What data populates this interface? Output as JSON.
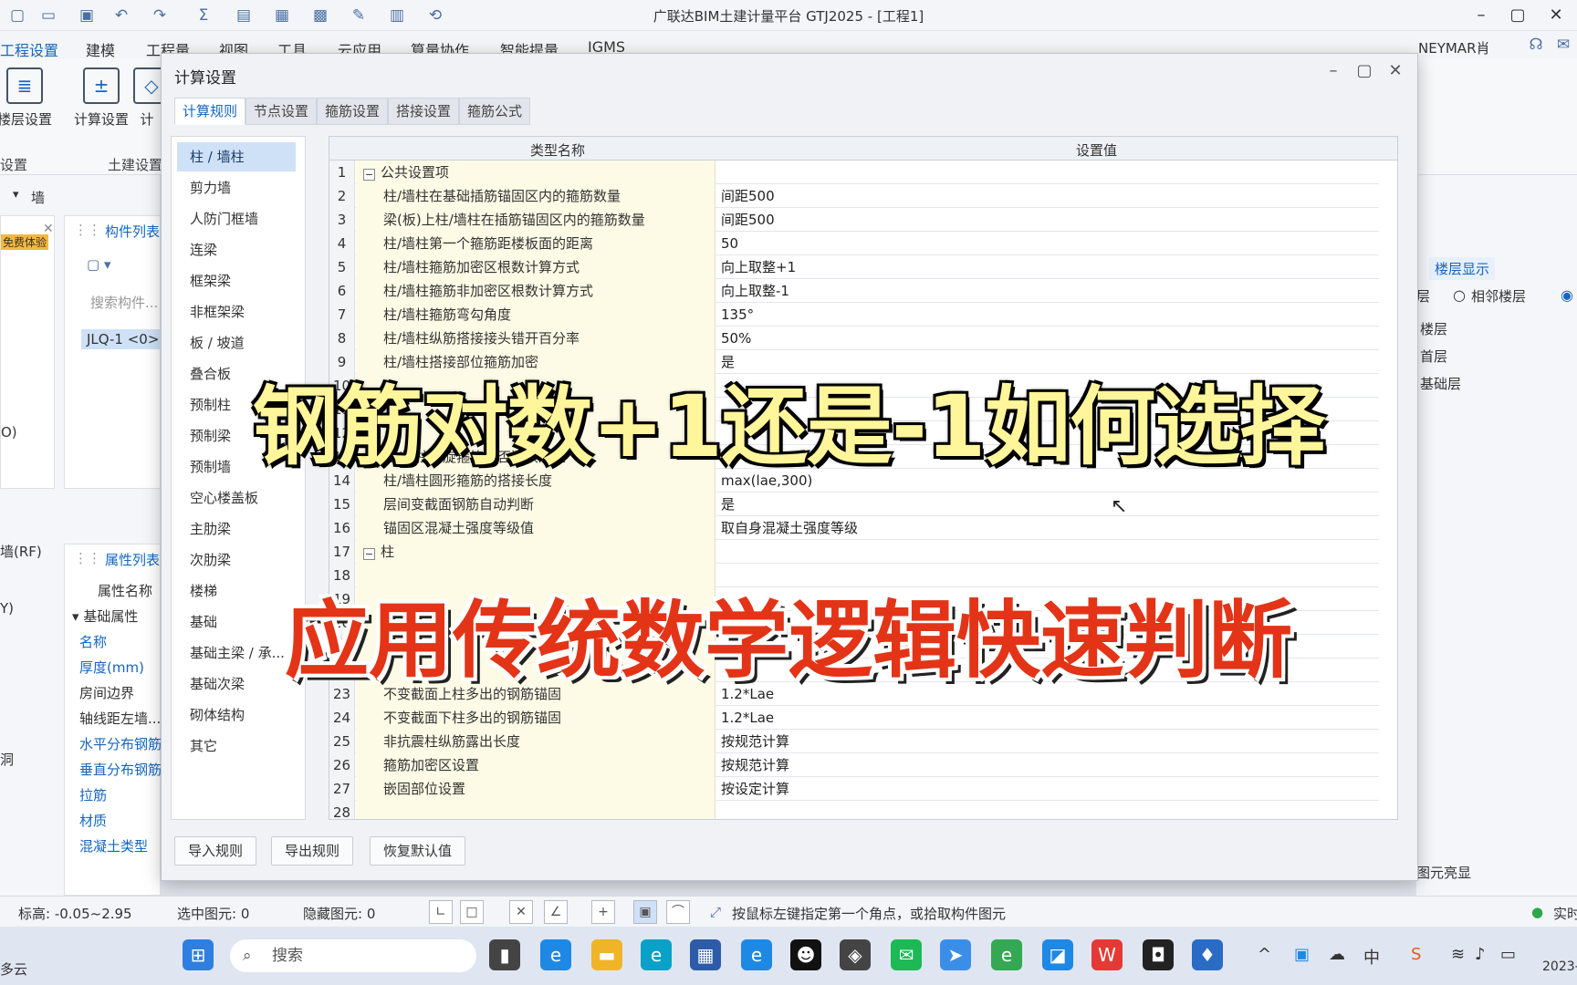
{
  "app": {
    "title": "广联达BIM土建计量平台 GTJ2025 - [工程1]",
    "user": "NEYMAR肖"
  },
  "menu": [
    "工程设置",
    "建模",
    "工程量",
    "视图",
    "工具",
    "云应用",
    "算量协作",
    "智能提量",
    "IGMS"
  ],
  "ribbon": {
    "buttons": [
      "楼层设置",
      "计算设置",
      "计"
    ],
    "groups": [
      "设置",
      "土建设置"
    ]
  },
  "left_panel": {
    "selector_label": "墙",
    "component_list_title": "构件列表",
    "search_placeholder": "搜索构件...",
    "item": "JLQ-1 <0>",
    "badge": "免费体验",
    "property_list_title": "属性列表",
    "prop_header": "属性名称",
    "prop_section": "基础属性",
    "props": [
      "名称",
      "厚度(mm)",
      "房间边界",
      "轴线距左墙...",
      "水平分布钢筋",
      "垂直分布钢筋",
      "拉筋",
      "材质",
      "混凝土类型"
    ],
    "edge_labels": [
      "O)",
      "墙(RF)",
      "Y)",
      "洞",
      "多云"
    ]
  },
  "right_panel": {
    "tab": "楼层显示",
    "radio_labels": [
      "层",
      "相邻楼层"
    ],
    "floors": [
      "楼层",
      "首层",
      "基础层"
    ],
    "bottom_label": "图元亮显"
  },
  "dialog": {
    "title": "计算设置",
    "tabs": [
      "计算规则",
      "节点设置",
      "箍筋设置",
      "搭接设置",
      "箍筋公式"
    ],
    "categories": [
      "柱 / 墙柱",
      "剪力墙",
      "人防门框墙",
      "连梁",
      "框架梁",
      "非框架梁",
      "板 / 坡道",
      "叠合板",
      "预制柱",
      "预制梁",
      "预制墙",
      "空心楼盖板",
      "主肋梁",
      "次肋梁",
      "楼梯",
      "基础",
      "基础主梁 / 承...",
      "基础次梁",
      "砌体结构",
      "其它"
    ],
    "grid_headers": [
      "类型名称",
      "设置值"
    ],
    "rows": [
      {
        "n": "1",
        "name": "公共设置项",
        "value": "",
        "group": true
      },
      {
        "n": "2",
        "name": "柱/墙柱在基础插筋锚固区内的箍筋数量",
        "value": "间距500"
      },
      {
        "n": "3",
        "name": "梁(板)上柱/墙柱在插筋锚固区内的箍筋数量",
        "value": "间距500"
      },
      {
        "n": "4",
        "name": "柱/墙柱第一个箍筋距楼板面的距离",
        "value": "50"
      },
      {
        "n": "5",
        "name": "柱/墙柱箍筋加密区根数计算方式",
        "value": "向上取整+1"
      },
      {
        "n": "6",
        "name": "柱/墙柱箍筋非加密区根数计算方式",
        "value": "向上取整-1"
      },
      {
        "n": "7",
        "name": "柱/墙柱箍筋弯勾角度",
        "value": "135°"
      },
      {
        "n": "8",
        "name": "柱/墙柱纵筋搭接接头错开百分率",
        "value": "50%"
      },
      {
        "n": "9",
        "name": "柱/墙柱搭接部位箍筋加密",
        "value": "是"
      },
      {
        "n": "10",
        "name": "",
        "value": ""
      },
      {
        "n": "11",
        "name": "",
        "value": ""
      },
      {
        "n": "12",
        "name": "",
        "value": ""
      },
      {
        "n": "13",
        "name": "柱/墙柱螺旋箍筋是否连续通过",
        "value": "是"
      },
      {
        "n": "14",
        "name": "柱/墙柱圆形箍筋的搭接长度",
        "value": "max(lae,300)"
      },
      {
        "n": "15",
        "name": "层间变截面钢筋自动判断",
        "value": "是"
      },
      {
        "n": "16",
        "name": "锚固区混凝土强度等级值",
        "value": "取自身混凝土强度等级"
      },
      {
        "n": "17",
        "name": "柱",
        "value": "",
        "group": true
      },
      {
        "n": "18",
        "name": "",
        "value": ""
      },
      {
        "n": "19",
        "name": "",
        "value": ""
      },
      {
        "n": "20",
        "name": "",
        "value": ""
      },
      {
        "n": "21",
        "name": "",
        "value": ""
      },
      {
        "n": "22",
        "name": "",
        "value": ""
      },
      {
        "n": "23",
        "name": "不变截面上柱多出的钢筋锚固",
        "value": "1.2*Lae"
      },
      {
        "n": "24",
        "name": "不变截面下柱多出的钢筋锚固",
        "value": "1.2*Lae"
      },
      {
        "n": "25",
        "name": "非抗震柱纵筋露出长度",
        "value": "按规范计算"
      },
      {
        "n": "26",
        "name": "箍筋加密区设置",
        "value": "按规范计算"
      },
      {
        "n": "27",
        "name": "嵌固部位设置",
        "value": "按设定计算"
      },
      {
        "n": "28",
        "name": "",
        "value": ""
      }
    ],
    "buttons": [
      "导入规则",
      "导出规则",
      "恢复默认值"
    ]
  },
  "statusbar": {
    "elevation": "标高:  -0.05~2.95",
    "selected": "选中图元: 0",
    "hidden": "隐藏图元: 0",
    "hint": "按鼠标左键指定第一个角点，或拾取构件图元",
    "right": "实时"
  },
  "taskbar": {
    "search": "搜索",
    "clock": "2023-"
  },
  "captions": {
    "line1": "钢筋对数+1还是-1如何选择",
    "line2": "应用传统数学逻辑快速判断"
  }
}
